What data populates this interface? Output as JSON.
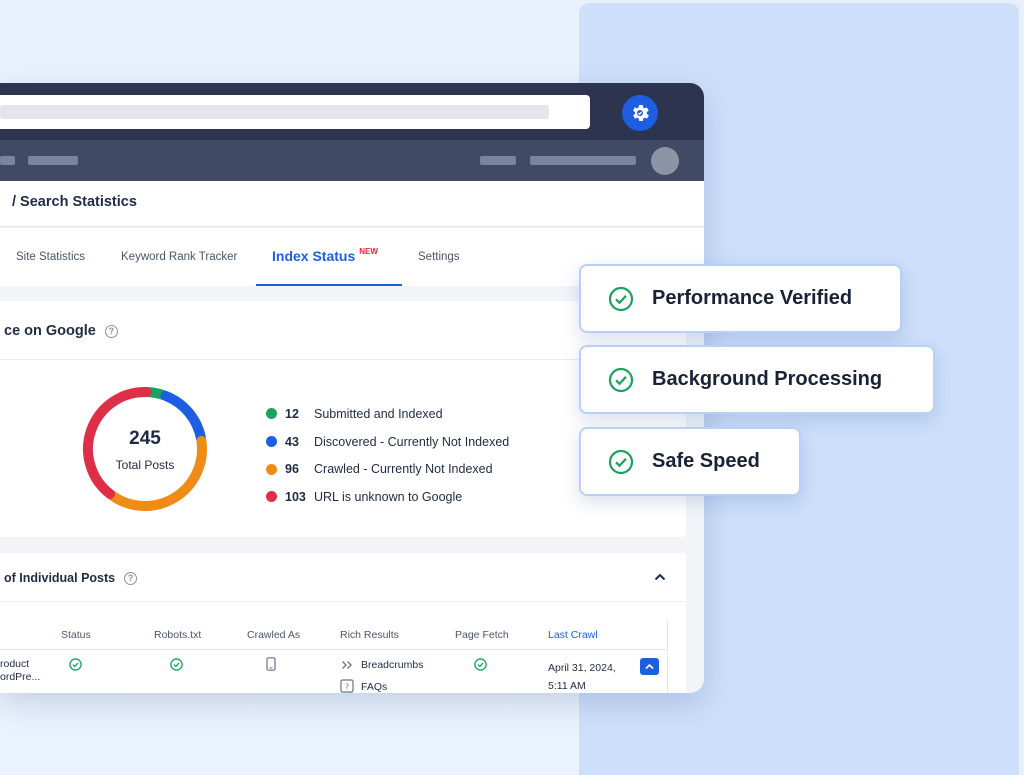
{
  "breadcrumb": "/ Search Statistics",
  "tabs": [
    {
      "label": "Site Statistics"
    },
    {
      "label": "Keyword Rank Tracker"
    },
    {
      "label": "Index Status",
      "badge": "NEW",
      "active": true
    },
    {
      "label": "Settings"
    }
  ],
  "performance_card": {
    "title": "ce on Google",
    "total": "245",
    "total_label": "Total Posts",
    "legend": [
      {
        "count": "12",
        "label": "Submitted and Indexed",
        "color": "#1aa35c"
      },
      {
        "count": "43",
        "label": "Discovered - Currently Not Indexed",
        "color": "#1d5fe0"
      },
      {
        "count": "96",
        "label": "Crawled - Currently Not Indexed",
        "color": "#f08c16"
      },
      {
        "count": "103",
        "label": "URL is unknown to Google",
        "color": "#df2e48"
      }
    ]
  },
  "posts_card": {
    "title": "of Individual Posts",
    "columns": [
      "Status",
      "Robots.txt",
      "Crawled As",
      "Rich Results",
      "Page Fetch",
      "Last Crawl"
    ],
    "row": {
      "name_line1": "roduct",
      "name_line2": "ordPre...",
      "rich_results": [
        "Breadcrumbs",
        "FAQs"
      ],
      "last_crawl_line1": "April 31, 2024,",
      "last_crawl_line2": "5:11 AM"
    }
  },
  "badges": [
    {
      "label": "Performance Verified"
    },
    {
      "label": "Background Processing"
    },
    {
      "label": "Safe Speed"
    }
  ],
  "colors": {
    "accent": "#1d5fe0",
    "success": "#1aa35c",
    "titlebar": "#2c3450",
    "navbar": "#404a64"
  }
}
